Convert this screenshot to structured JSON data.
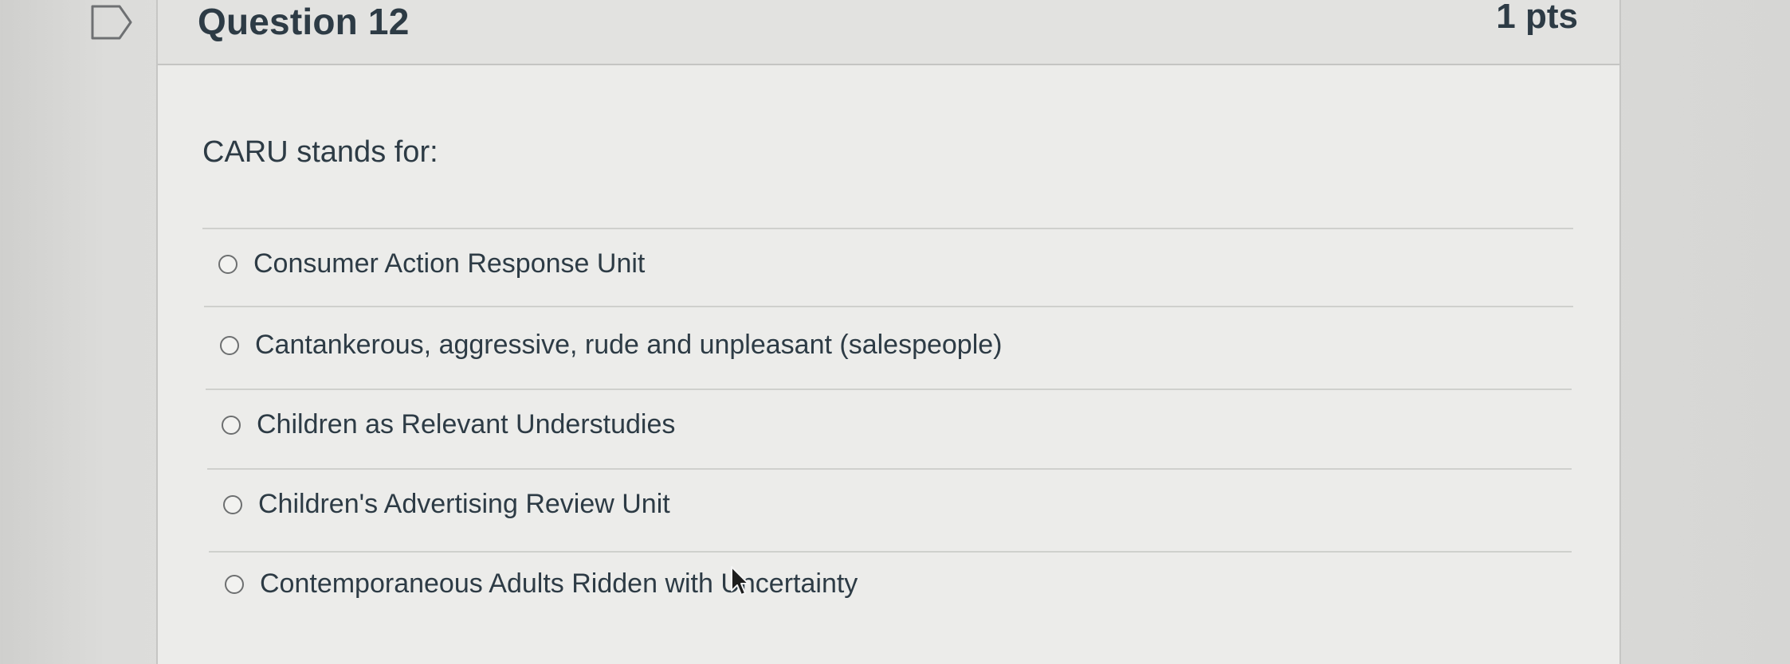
{
  "question": {
    "title": "Question 12",
    "points": "1 pts",
    "prompt": "CARU stands for:",
    "answers": [
      {
        "label": "Consumer Action Response Unit"
      },
      {
        "label": "Cantankerous, aggressive, rude and unpleasant (salespeople)"
      },
      {
        "label": "Children as Relevant Understudies"
      },
      {
        "label": "Children's Advertising Review Unit"
      },
      {
        "label": "Contemporaneous Adults Ridden with Uncertainty"
      }
    ]
  },
  "icons": {
    "flag": "flag-icon",
    "cursor": "mouse-pointer-icon"
  },
  "colors": {
    "text": "#2d3b45",
    "card_background": "#ececea",
    "header_background": "#e2e2e0",
    "divider": "#cfd0cd"
  }
}
